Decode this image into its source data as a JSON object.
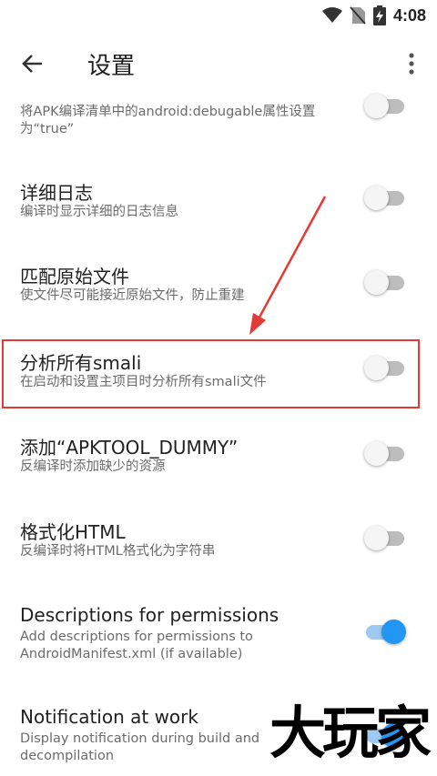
{
  "status": {
    "time": "4:08"
  },
  "toolbar": {
    "title": "设置"
  },
  "items": [
    {
      "title": "",
      "subtitle": "将APK编译清单中的android:debugable属性设置为“true”",
      "on": false
    },
    {
      "title": "详细日志",
      "subtitle": "编译时显示详细的日志信息",
      "on": false
    },
    {
      "title": "匹配原始文件",
      "subtitle": "使文件尽可能接近原始文件，防止重建",
      "on": false
    },
    {
      "title": "分析所有smali",
      "subtitle": "在启动和设置主项目时分析所有smali文件",
      "on": false
    },
    {
      "title": "添加“APKTOOL_DUMMY”",
      "subtitle": "反编译时添加缺少的资源",
      "on": false
    },
    {
      "title": "格式化HTML",
      "subtitle": "反编译时将HTML格式化为字符串",
      "on": false
    },
    {
      "title": "Descriptions for permissions",
      "subtitle": "Add descriptions for permissions to AndroidManifest.xml (if available)",
      "on": true
    },
    {
      "title": "Notification at work",
      "subtitle": "Display notification during build and decompilation",
      "on": true
    }
  ],
  "watermark": "大玩家",
  "colors": {
    "accent": "#2196f3",
    "highlight": "#e53935"
  }
}
